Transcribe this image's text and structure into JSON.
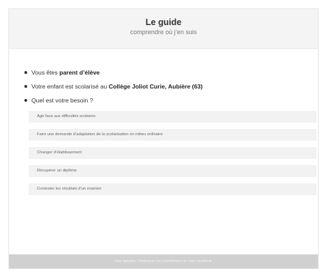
{
  "header": {
    "title": "Le guide",
    "subtitle": "comprendre où j’en suis"
  },
  "context": {
    "role_prefix": "Vous êtes ",
    "role_value": "parent d’élève",
    "school_prefix": "Votre enfant est scolarisé au ",
    "school_value": "Collège Joliot Curie, Aubière (63)",
    "question": "Quel est votre besoin ?"
  },
  "options": [
    {
      "label": "Agir face aux difficultés scolaires"
    },
    {
      "label": "Faire une demande d’adaptation de la scolarisation en milieu ordinaire"
    },
    {
      "label": "Changer d’établissement"
    },
    {
      "label": "Récupérer un diplôme"
    },
    {
      "label": "Contester les résultats d’un examen"
    }
  ],
  "footer": {
    "text": "Une question ? Retrouvez les coordonnées de votre académie"
  }
}
